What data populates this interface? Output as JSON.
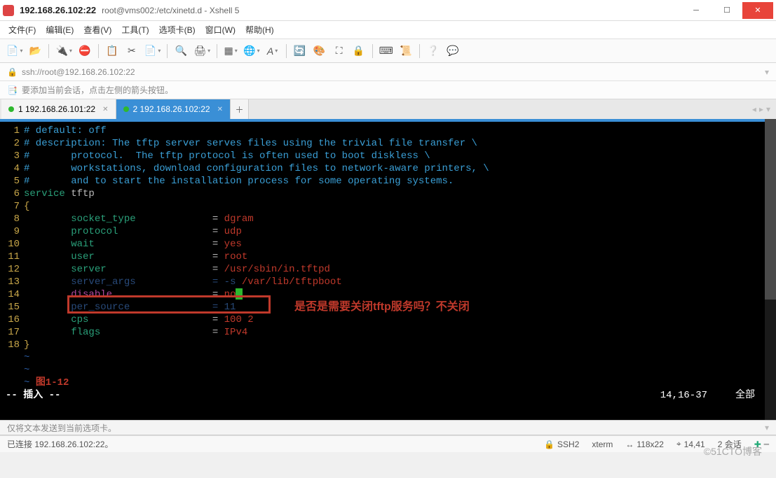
{
  "titlebar": {
    "ip": "192.168.26.102:22",
    "path": "root@vms002:/etc/xinetd.d - Xshell 5"
  },
  "menu": {
    "file": "文件(F)",
    "edit": "编辑(E)",
    "view": "查看(V)",
    "tools": "工具(T)",
    "tabs": "选项卡(B)",
    "window": "窗口(W)",
    "help": "帮助(H)"
  },
  "address": {
    "url": "ssh://root@192.168.26.102:22"
  },
  "hint": {
    "text": "要添加当前会话，点击左侧的箭头按钮。"
  },
  "tabs": [
    {
      "label": "1 192.168.26.101:22",
      "active": false
    },
    {
      "label": "2 192.168.26.102:22",
      "active": true
    }
  ],
  "editor": {
    "lines": [
      {
        "n": "1",
        "segs": [
          {
            "t": "# default: off",
            "c": "c-comment"
          }
        ]
      },
      {
        "n": "2",
        "segs": [
          {
            "t": "# description: The tftp server serves files using the trivial file transfer \\",
            "c": "c-comment"
          }
        ]
      },
      {
        "n": "3",
        "segs": [
          {
            "t": "#       protocol.  The tftp protocol is often used to boot diskless \\",
            "c": "c-comment"
          }
        ]
      },
      {
        "n": "4",
        "segs": [
          {
            "t": "#       workstations, download configuration files to network-aware printers, \\",
            "c": "c-comment"
          }
        ]
      },
      {
        "n": "5",
        "segs": [
          {
            "t": "#       and to start the installation process for some operating systems.",
            "c": "c-comment"
          }
        ]
      },
      {
        "n": "6",
        "segs": [
          {
            "t": "service ",
            "c": "c-kw"
          },
          {
            "t": "tftp",
            "c": ""
          }
        ]
      },
      {
        "n": "7",
        "segs": [
          {
            "t": "{",
            "c": "c-brace"
          }
        ]
      },
      {
        "n": "8",
        "segs": [
          {
            "t": "        socket_type",
            "c": "c-key"
          },
          {
            "t": "             = ",
            "c": "c-eq"
          },
          {
            "t": "dgram",
            "c": "c-val"
          }
        ]
      },
      {
        "n": "9",
        "segs": [
          {
            "t": "        protocol",
            "c": "c-key"
          },
          {
            "t": "                = ",
            "c": "c-eq"
          },
          {
            "t": "udp",
            "c": "c-val"
          }
        ]
      },
      {
        "n": "10",
        "segs": [
          {
            "t": "        wait",
            "c": "c-key"
          },
          {
            "t": "                    = ",
            "c": "c-eq"
          },
          {
            "t": "yes",
            "c": "c-val"
          }
        ]
      },
      {
        "n": "11",
        "segs": [
          {
            "t": "        user",
            "c": "c-key"
          },
          {
            "t": "                    = ",
            "c": "c-eq"
          },
          {
            "t": "root",
            "c": "c-val"
          }
        ]
      },
      {
        "n": "12",
        "segs": [
          {
            "t": "        server",
            "c": "c-key"
          },
          {
            "t": "                  = ",
            "c": "c-eq"
          },
          {
            "t": "/usr/sbin/in.tftpd",
            "c": "c-val"
          }
        ]
      },
      {
        "n": "13",
        "segs": [
          {
            "t": "        server_args",
            "c": "c-args"
          },
          {
            "t": "             = ",
            "c": "c-args"
          },
          {
            "t": "-s ",
            "c": "c-args"
          },
          {
            "t": "/var/lib/tftpboot",
            "c": "c-val"
          }
        ]
      },
      {
        "n": "14",
        "segs": [
          {
            "t": "        disable",
            "c": "c-disable"
          },
          {
            "t": "                 = ",
            "c": "c-eq"
          },
          {
            "t": "no",
            "c": "c-no"
          },
          {
            "t": "█",
            "c": "cursor-span"
          }
        ]
      },
      {
        "n": "15",
        "segs": [
          {
            "t": "        per_source",
            "c": "c-args"
          },
          {
            "t": "              = ",
            "c": "c-args"
          },
          {
            "t": "11",
            "c": "c-args"
          }
        ]
      },
      {
        "n": "16",
        "segs": [
          {
            "t": "        cps",
            "c": "c-key"
          },
          {
            "t": "                     = ",
            "c": "c-eq"
          },
          {
            "t": "100 2",
            "c": "c-val"
          }
        ]
      },
      {
        "n": "17",
        "segs": [
          {
            "t": "        flags",
            "c": "c-key"
          },
          {
            "t": "                   = ",
            "c": "c-eq"
          },
          {
            "t": "IPv4",
            "c": "c-val"
          }
        ]
      },
      {
        "n": "18",
        "segs": [
          {
            "t": "}",
            "c": "c-brace"
          }
        ]
      }
    ],
    "tildes": [
      "~",
      "~",
      "~"
    ],
    "fig_label": "图1-12",
    "mode": "-- 插入 --",
    "pos": "14,16-37",
    "scroll": "全部",
    "annotation": "是否是需要关闭tftp服务吗？不关闭"
  },
  "input_hint": "仅将文本发送到当前选项卡。",
  "status": {
    "conn": "已连接 192.168.26.102:22。",
    "proto": "SSH2",
    "term": "xterm",
    "size": "118x22",
    "cursor": "14,41",
    "sessions": "2 会话"
  },
  "watermark": "©51CTO博客"
}
